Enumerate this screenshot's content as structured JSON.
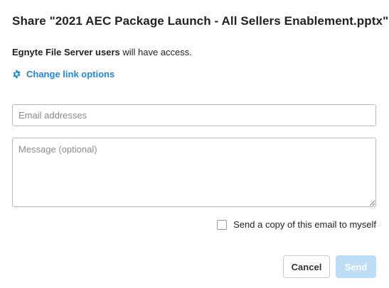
{
  "dialog": {
    "title": "Share \"2021 AEC Package Launch - All Sellers Enablement.pptx\"",
    "access_group": "Egnyte File Server users",
    "access_suffix": " will have access.",
    "link_options_label": "Change link options",
    "link_options_icon": "gear-icon",
    "accent_color": "#1e88e5"
  },
  "form": {
    "email_placeholder": "Email addresses",
    "email_value": "",
    "message_placeholder": "Message (optional)",
    "message_value": "",
    "copy_label": "Send a copy of this email to myself",
    "copy_checked": false
  },
  "footer": {
    "cancel_label": "Cancel",
    "send_label": "Send",
    "send_disabled": true,
    "send_color": "#bcdcf8"
  }
}
